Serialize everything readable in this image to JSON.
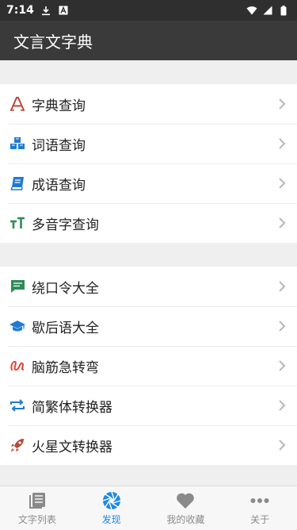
{
  "status": {
    "time": "7:14"
  },
  "app": {
    "title": "文言文字典"
  },
  "groups": [
    {
      "items": [
        {
          "label": "字典查询",
          "icon": "font-a-icon"
        },
        {
          "label": "词语查询",
          "icon": "cubes-icon"
        },
        {
          "label": "成语查询",
          "icon": "book-icon"
        },
        {
          "label": "多音字查询",
          "icon": "text-height-icon"
        }
      ]
    },
    {
      "items": [
        {
          "label": "绕口令大全",
          "icon": "comment-icon"
        },
        {
          "label": "歇后语大全",
          "icon": "graduation-cap-icon"
        },
        {
          "label": "脑筋急转弯",
          "icon": "squiggle-icon"
        },
        {
          "label": "简繁体转换器",
          "icon": "swap-icon"
        },
        {
          "label": "火星文转换器",
          "icon": "rocket-icon"
        }
      ]
    }
  ],
  "tabs": [
    {
      "label": "文字列表",
      "icon": "book-list-icon",
      "active": false
    },
    {
      "label": "发现",
      "icon": "aperture-icon",
      "active": true
    },
    {
      "label": "我的收藏",
      "icon": "heart-icon",
      "active": false
    },
    {
      "label": "关于",
      "icon": "more-icon",
      "active": false
    }
  ],
  "colors": {
    "active_tab": "#1e88e5",
    "appbar": "#3a3a3a"
  }
}
